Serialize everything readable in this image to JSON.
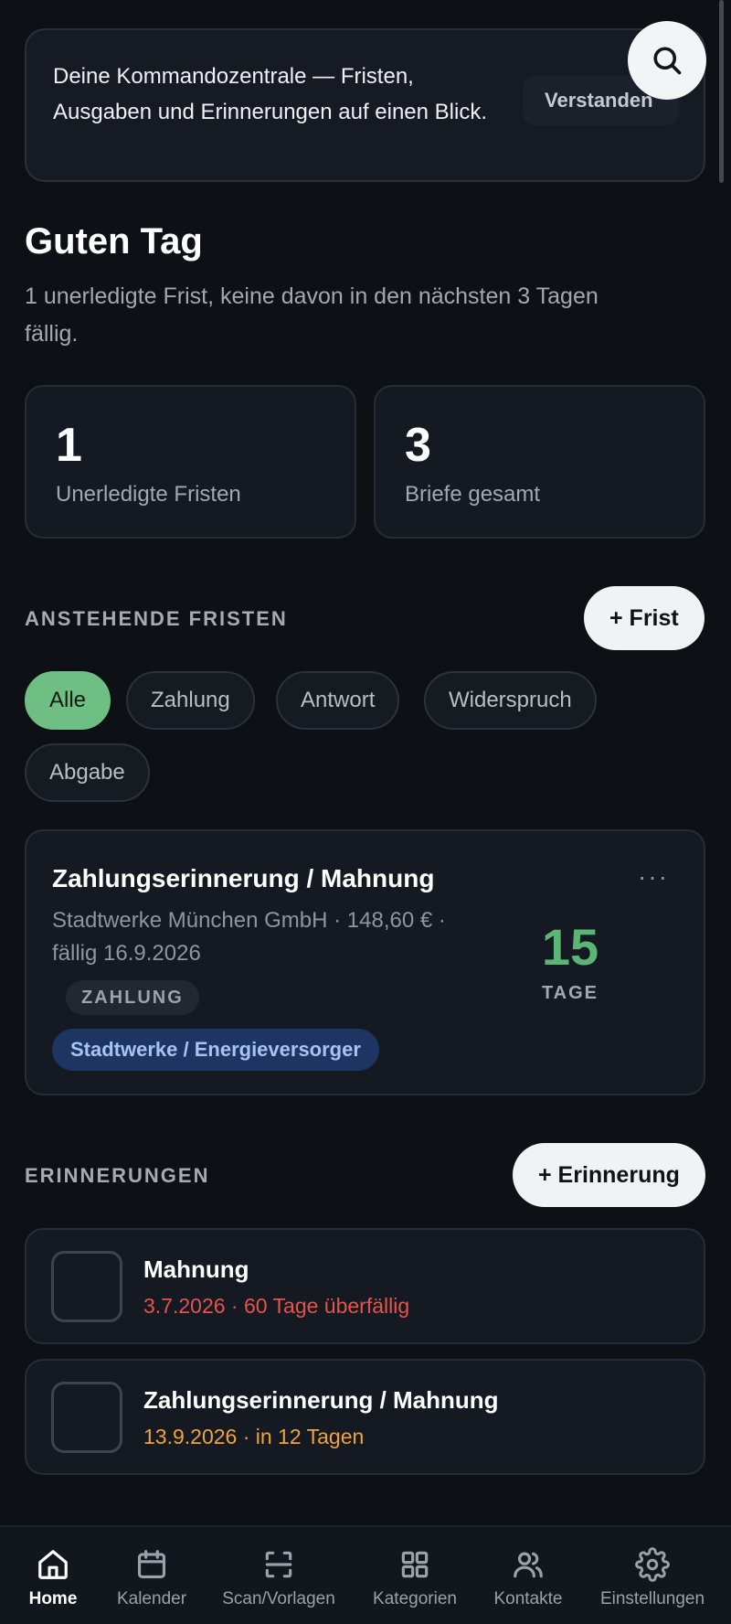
{
  "banner": {
    "text": "Deine Kommandozentrale — Fristen, Ausgaben und Erinnerungen auf einen Blick.",
    "dismiss_label": "Verstanden"
  },
  "greeting": {
    "title": "Guten Tag",
    "subtitle": "1 unerledigte Frist, keine davon in den nächsten 3 Tagen fällig."
  },
  "stats": [
    {
      "value": "1",
      "label": "Unerledigte Fristen"
    },
    {
      "value": "3",
      "label": "Briefe gesamt"
    }
  ],
  "deadlines": {
    "section_title": "ANSTEHENDE FRISTEN",
    "add_label": "+ Frist",
    "filters": [
      "Alle",
      "Zahlung",
      "Antwort",
      "Widerspruch",
      "Abgabe"
    ],
    "active_filter": "Alle",
    "items": [
      {
        "title": "Zahlungserinnerung / Mahnung",
        "meta": "Stadtwerke München GmbH · 148,60 € · fällig 16.9.2026",
        "days": "15",
        "days_label": "TAGE",
        "type": "ZAHLUNG",
        "category": "Stadtwerke / Energieversorger",
        "more": "···"
      }
    ]
  },
  "reminders": {
    "section_title": "ERINNERUNGEN",
    "add_label": "+ Erinnerung",
    "items": [
      {
        "title": "Mahnung",
        "subtitle": "3.7.2026 · 60 Tage überfällig",
        "status_color": "#e5534b"
      },
      {
        "title": "Zahlungserinnerung / Mahnung",
        "subtitle": "13.9.2026 · in 12 Tagen",
        "status_color": "#f0a33a"
      }
    ]
  },
  "nav": [
    {
      "label": "Home",
      "icon": "home-icon"
    },
    {
      "label": "Kalender",
      "icon": "calendar-icon"
    },
    {
      "label": "Scan/Vorlagen",
      "icon": "scan-icon"
    },
    {
      "label": "Kategorien",
      "icon": "grid-icon"
    },
    {
      "label": "Kontakte",
      "icon": "contacts-icon"
    },
    {
      "label": "Einstellungen",
      "icon": "gear-icon"
    }
  ],
  "colors": {
    "background": "#0d1015",
    "card": "#151a22",
    "accent_green": "#6fbf84",
    "overdue_red": "#e5534b",
    "upcoming_orange": "#f0a33a",
    "category_blue": "#1e3564"
  }
}
